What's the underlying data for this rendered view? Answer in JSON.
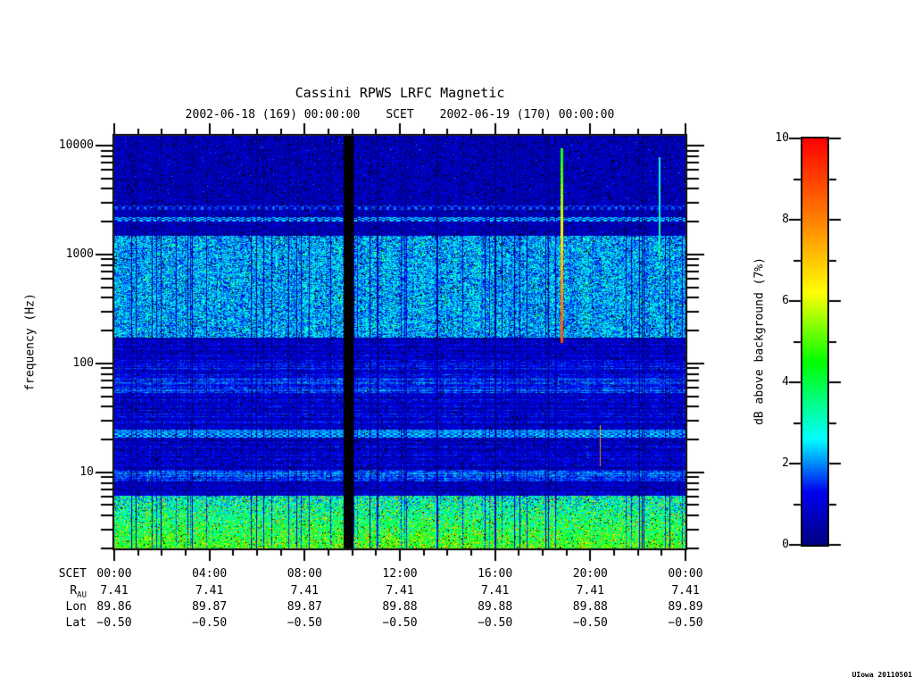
{
  "title": "Cassini RPWS LRFC Magnetic",
  "subtitle": {
    "start": "2002-06-18 (169) 00:00:00",
    "scet": "SCET",
    "end": "2002-06-19 (170) 00:00:00"
  },
  "watermark": "UIowa 20110501",
  "y_axis": {
    "label": "frequency (Hz)",
    "tick_labels": [
      "10000",
      "1000",
      "100",
      "10"
    ]
  },
  "x_axis": {
    "rows": [
      {
        "label": "SCET",
        "sub": "",
        "values": [
          "00:00",
          "04:00",
          "08:00",
          "12:00",
          "16:00",
          "20:00",
          "00:00"
        ]
      },
      {
        "label": "R",
        "sub": "AU",
        "values": [
          "7.41",
          "7.41",
          "7.41",
          "7.41",
          "7.41",
          "7.41",
          "7.41"
        ]
      },
      {
        "label": "Lon",
        "sub": "",
        "values": [
          "89.86",
          "89.87",
          "89.87",
          "89.88",
          "89.88",
          "89.88",
          "89.89"
        ]
      },
      {
        "label": "Lat",
        "sub": "",
        "values": [
          "−0.50",
          "−0.50",
          "−0.50",
          "−0.50",
          "−0.50",
          "−0.50",
          "−0.50"
        ]
      }
    ]
  },
  "colorbar": {
    "label": "dB above background (7%)",
    "min": 0,
    "max": 10,
    "tick_labels": [
      "10",
      "8",
      "6",
      "4",
      "2",
      "0"
    ],
    "minor_tick_step": 1
  },
  "chart_data": {
    "type": "heatmap",
    "title": "Cassini RPWS LRFC Magnetic",
    "xlabel": "SCET",
    "ylabel": "frequency (Hz)",
    "x_range_hours": [
      0,
      24
    ],
    "x_major_tick_hours": [
      0,
      4,
      8,
      12,
      16,
      20,
      24
    ],
    "x_minor_tick_step_hours": 1,
    "y_scale": "log",
    "y_log_range_hz": [
      2.0,
      12300
    ],
    "y_major_ticks_hz": [
      10,
      100,
      1000,
      10000
    ],
    "value_units": "dB above background (7%)",
    "value_range": [
      0,
      10
    ],
    "legend_position": "right-colorbar",
    "grid": false,
    "ephemeris": {
      "R_AU": [
        7.41,
        7.41,
        7.41,
        7.41,
        7.41,
        7.41,
        7.41
      ],
      "Lon": [
        89.86,
        89.87,
        89.87,
        89.88,
        89.88,
        89.88,
        89.89
      ],
      "Lat": [
        -0.5,
        -0.5,
        -0.5,
        -0.5,
        -0.5,
        -0.5,
        -0.5
      ]
    },
    "spectrogram": {
      "seed": 1337,
      "colormap": [
        [
          0.0,
          0,
          0,
          130
        ],
        [
          1.3,
          0,
          0,
          240
        ],
        [
          2.6,
          0,
          255,
          255
        ],
        [
          4.5,
          0,
          255,
          0
        ],
        [
          6.2,
          255,
          255,
          0
        ],
        [
          8.0,
          255,
          128,
          0
        ],
        [
          10.0,
          255,
          0,
          0
        ]
      ],
      "texture": {
        "streak_p": 0.07,
        "streak_min": 0.12,
        "streak_max": 0.55,
        "streak_wide_p": 0.3,
        "col_jitter": 0.12,
        "row_jitter": 0.8
      },
      "bands": [
        {
          "y0": 0.0,
          "y1": 0.168,
          "freq_hz": [
            12300,
            2850
          ],
          "base": 0.75,
          "noise": 0.5,
          "speckle_p": 0.025,
          "speckle_boost": 1.6,
          "black_p": 0.1,
          "smooth": 0.35,
          "desc": "dark blue background with black dropout streaks"
        },
        {
          "y0": 0.168,
          "y1": 0.178,
          "freq_hz": [
            2850,
            2600
          ],
          "base": 0.95,
          "noise": 0.4,
          "dotted": 1,
          "dot_boost": 0.9,
          "black_p": 0.05,
          "smooth": 0.3,
          "desc": "faint dotted narrowband line"
        },
        {
          "y0": 0.178,
          "y1": 0.195,
          "freq_hz": [
            2600,
            2250
          ],
          "base": 0.75,
          "noise": 0.5,
          "speckle_p": 0.02,
          "speckle_boost": 1.4,
          "black_p": 0.1,
          "smooth": 0.35,
          "desc": "dark blue background"
        },
        {
          "y0": 0.195,
          "y1": 0.207,
          "freq_hz": [
            2250,
            2050
          ],
          "base": 1.5,
          "noise": 0.5,
          "dotted": 1,
          "dot_boost": 1.2,
          "black_p": 0.04,
          "smooth": 0.3,
          "desc": "bright dotted narrowband emission ~2.1 kHz"
        },
        {
          "y0": 0.207,
          "y1": 0.242,
          "freq_hz": [
            2050,
            1500
          ],
          "base": 0.75,
          "noise": 0.5,
          "speckle_p": 0.02,
          "speckle_boost": 1.4,
          "black_p": 0.1,
          "smooth": 0.35,
          "desc": "dark blue background"
        },
        {
          "y0": 0.242,
          "y1": 0.489,
          "freq_hz": [
            1500,
            175
          ],
          "base": 2.15,
          "noise": 1.15,
          "speckle_p": 0.05,
          "speckle_boost": 1.8,
          "red_p": 0.0035,
          "black_p": 0.06,
          "smooth": 0.25,
          "desc": "bright cyan-green broadband emission band"
        },
        {
          "y0": 0.489,
          "y1": 0.54,
          "freq_hz": [
            175,
            110
          ],
          "base": 0.95,
          "noise": 0.55,
          "black_p": 0.09,
          "row_coh": 1,
          "smooth": 0.55,
          "desc": "darker strip"
        },
        {
          "y0": 0.54,
          "y1": 0.588,
          "freq_hz": [
            110,
            73
          ],
          "base": 1.2,
          "noise": 0.6,
          "black_p": 0.07,
          "row_coh": 1,
          "smooth": 0.55,
          "desc": "medium blue streaky"
        },
        {
          "y0": 0.588,
          "y1": 0.622,
          "freq_hz": [
            73,
            54
          ],
          "base": 1.45,
          "noise": 0.7,
          "speckle_p": 0.06,
          "speckle_boost": 1.2,
          "black_p": 0.06,
          "row_coh": 1,
          "smooth": 0.5,
          "desc": "brighter speckle band"
        },
        {
          "y0": 0.622,
          "y1": 0.712,
          "freq_hz": [
            54,
            25
          ],
          "base": 1.1,
          "noise": 0.55,
          "black_p": 0.08,
          "row_coh": 1,
          "smooth": 0.55,
          "desc": "medium blue streaky"
        },
        {
          "y0": 0.712,
          "y1": 0.73,
          "freq_hz": [
            25,
            22
          ],
          "base": 1.65,
          "noise": 0.5,
          "dotted": 1,
          "dot_boost": 1.0,
          "black_p": 0.04,
          "smooth": 0.45,
          "desc": "dotted cyan narrowband line ~24 Hz"
        },
        {
          "y0": 0.73,
          "y1": 0.808,
          "freq_hz": [
            22,
            11
          ],
          "base": 1.0,
          "noise": 0.5,
          "black_p": 0.1,
          "row_coh": 1,
          "smooth": 0.55,
          "desc": "dark blue streaky"
        },
        {
          "y0": 0.808,
          "y1": 0.836,
          "freq_hz": [
            11,
            8.8
          ],
          "base": 1.6,
          "noise": 0.8,
          "speckle_p": 0.09,
          "speckle_boost": 1.1,
          "black_p": 0.05,
          "row_coh": 1,
          "smooth": 0.5,
          "desc": "enhanced cyan blobs ~9 Hz"
        },
        {
          "y0": 0.836,
          "y1": 0.872,
          "freq_hz": [
            8.8,
            6.4
          ],
          "base": 0.9,
          "noise": 0.5,
          "black_p": 0.1,
          "row_coh": 1,
          "smooth": 0.5,
          "desc": "dark strip"
        },
        {
          "y0": 0.872,
          "y1": 1.0,
          "freq_hz": [
            6.4,
            2.0
          ],
          "base": 2.4,
          "base_end": 4.3,
          "noise": 1.3,
          "speckle_p": 0.28,
          "speckle_boost": 3.2,
          "red_p": 0.07,
          "black_p": 0.03,
          "smooth": 0.15,
          "desc": "intense multicolour low-frequency noise"
        }
      ],
      "features": [
        {
          "type": "data_gap",
          "x0": 0.401,
          "x1": 0.4175,
          "y0": 0.0,
          "y1": 1.0,
          "desc": "black vertical data gap near 09:40"
        },
        {
          "type": "burst_line",
          "x": 0.7828,
          "w": 0.004,
          "y0": 0.03,
          "y1": 0.5,
          "v0": 4.0,
          "v1": 8.5,
          "desc": "intense narrow burst near 18:47"
        },
        {
          "type": "burst_line",
          "x": 0.85,
          "w": 0.0022,
          "y0": 0.7,
          "y1": 0.8,
          "v0": 6.5,
          "v1": 8.0,
          "desc": "weak red streak near 20:24"
        },
        {
          "type": "burst_line",
          "x": 0.954,
          "w": 0.003,
          "y0": 0.05,
          "y1": 0.3,
          "v0": 2.2,
          "v1": 3.0,
          "desc": "faint cyan streak near 22:54"
        }
      ]
    }
  }
}
